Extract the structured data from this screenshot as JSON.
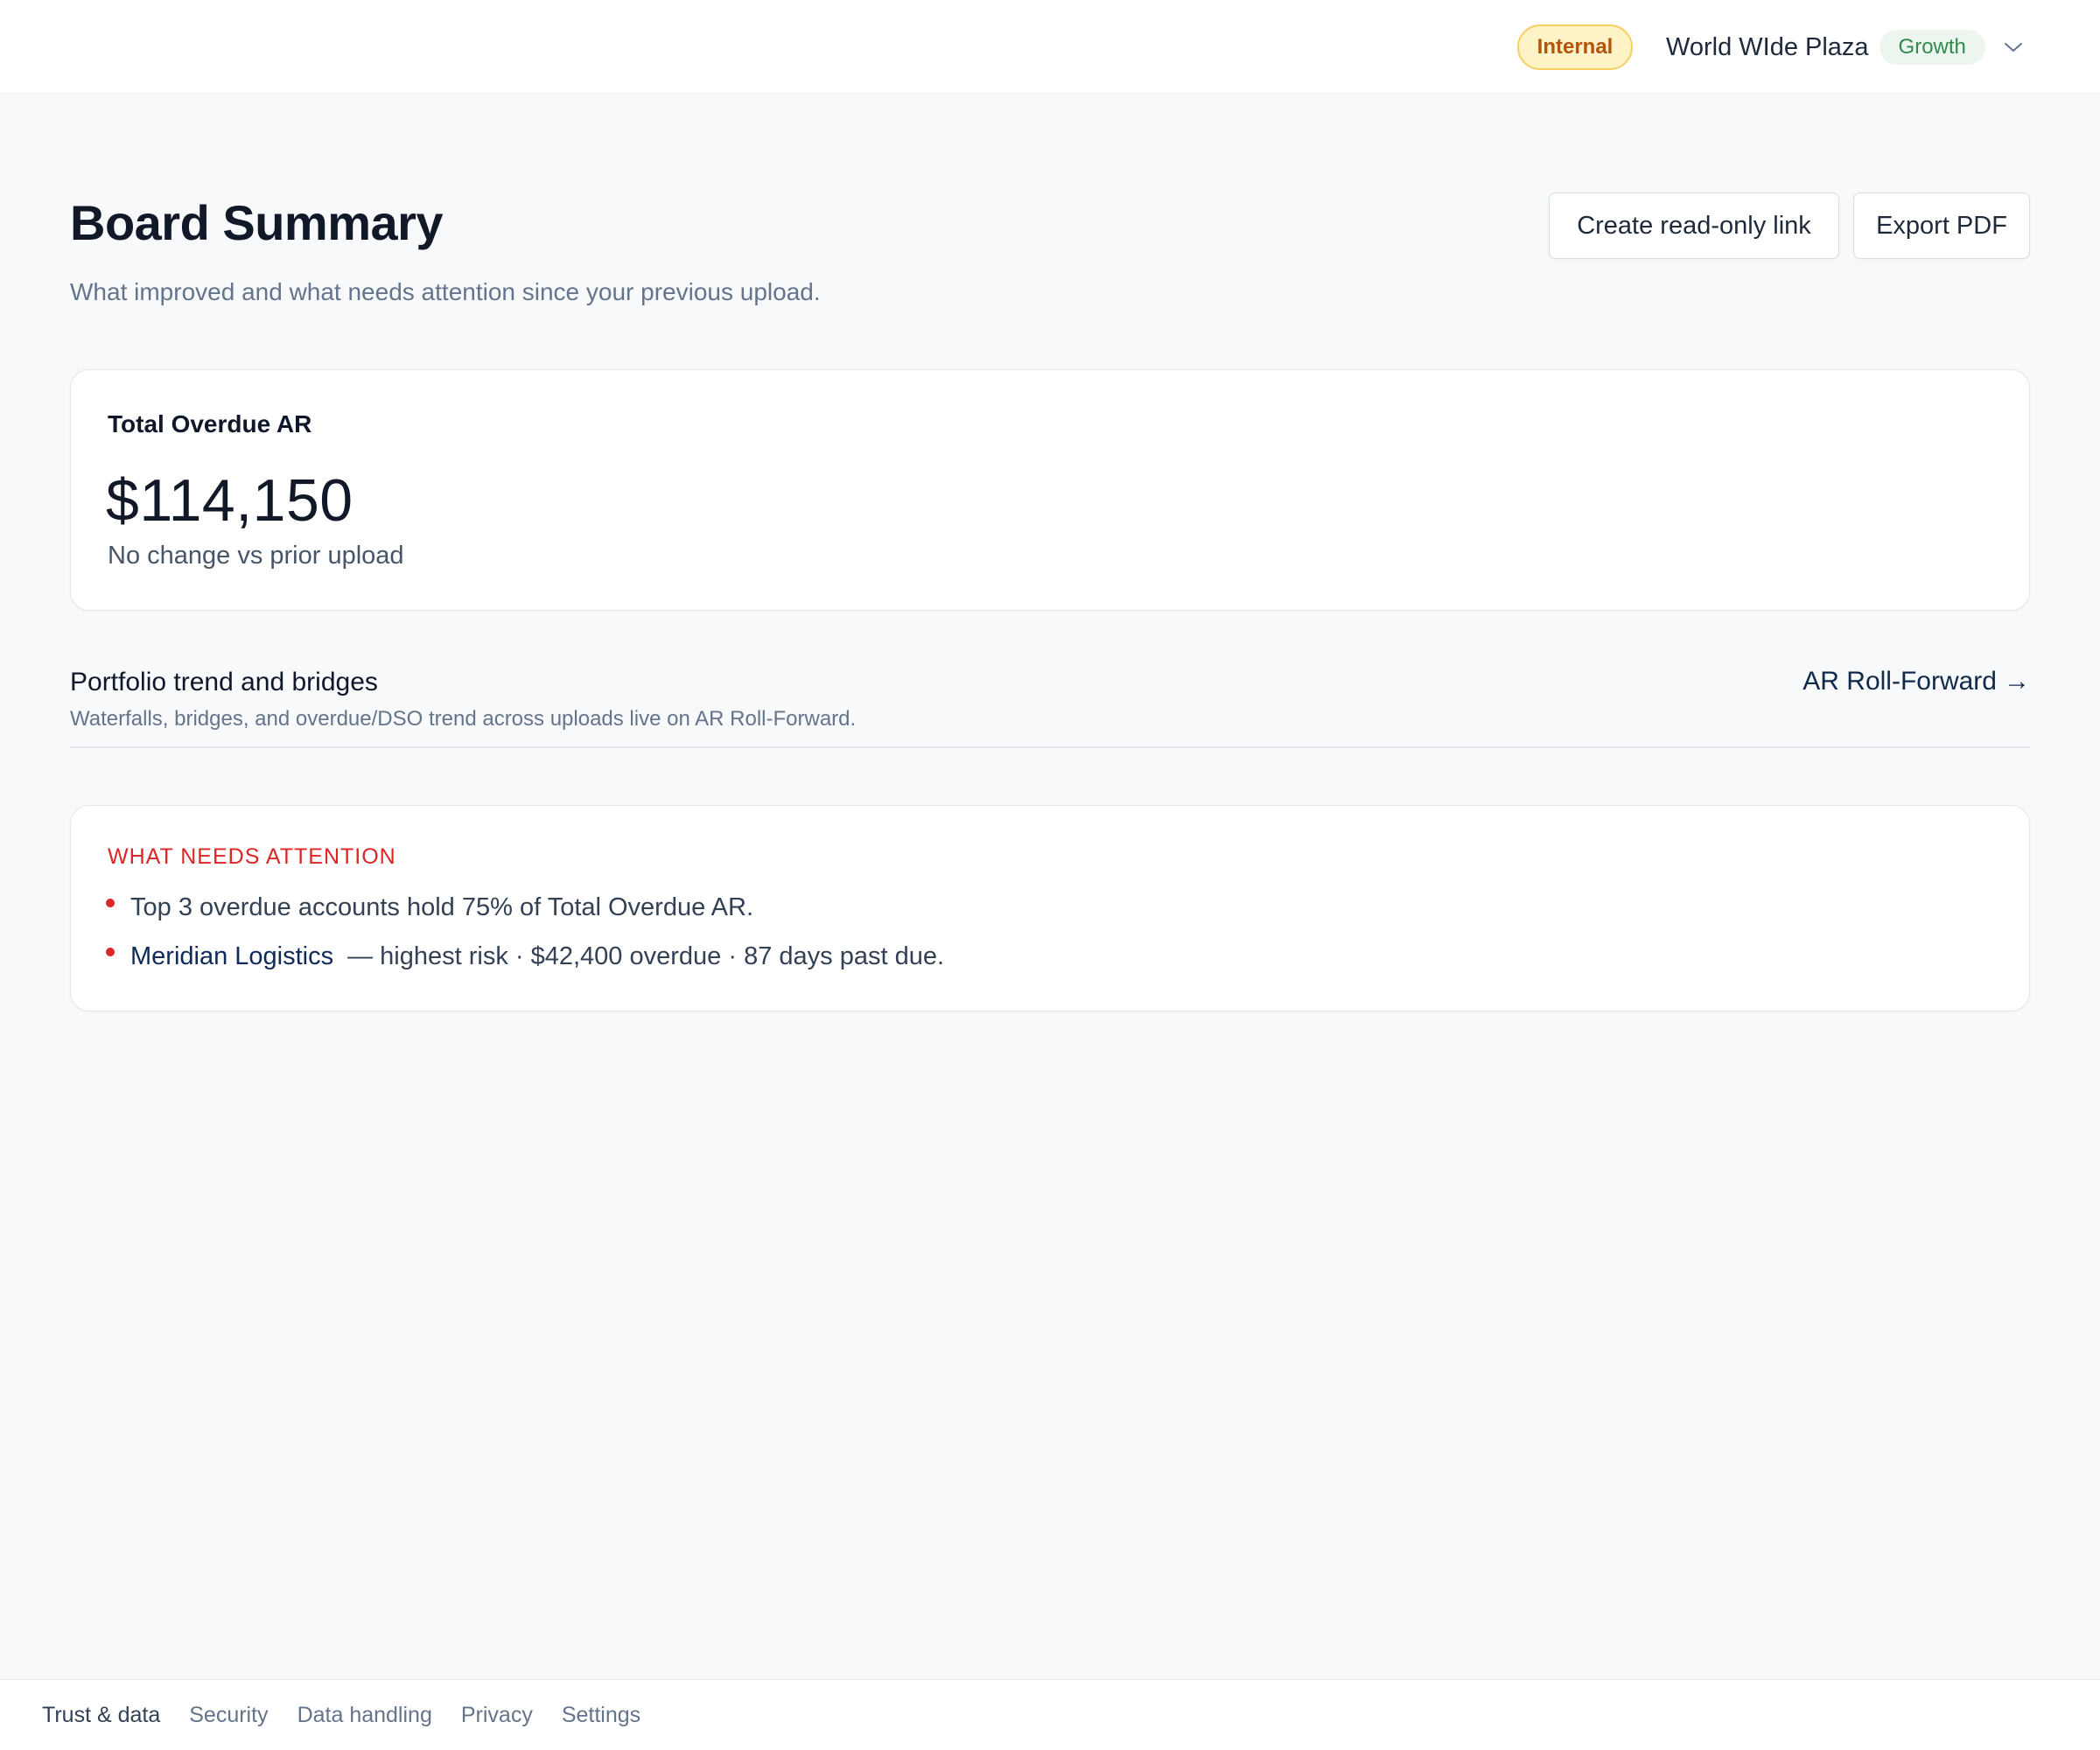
{
  "topbar": {
    "env_badge": "Internal",
    "org_name": "World WIde Plaza",
    "plan_badge": "Growth"
  },
  "header": {
    "title": "Board Summary",
    "subtitle": "What improved and what needs attention since your previous upload.",
    "create_link_label": "Create read-only link",
    "export_pdf_label": "Export PDF"
  },
  "kpi": {
    "label": "Total Overdue AR",
    "value": "$114,150",
    "delta": "No change vs prior upload"
  },
  "portfolio": {
    "title": "Portfolio trend and bridges",
    "description": "Waterfalls, bridges, and overdue/DSO trend across uploads live on AR Roll-Forward.",
    "link_label": "AR Roll-Forward",
    "link_arrow": "→"
  },
  "attention": {
    "heading": "WHAT NEEDS ATTENTION",
    "items": [
      {
        "text": "Top 3 overdue accounts hold 75% of Total Overdue AR."
      },
      {
        "link": "Meridian Logistics",
        "text": "— highest risk · $42,400 overdue · 87 days past due."
      }
    ]
  },
  "footer": {
    "items": [
      "Trust & data",
      "Security",
      "Data handling",
      "Privacy",
      "Settings"
    ]
  },
  "colors": {
    "accent_red": "#dc2626",
    "plan_green": "#2f8a4c",
    "env_amber": "#b4530a"
  },
  "icons": {
    "org_switcher": "chevron-down-icon",
    "roll_forward": "arrow-right-icon",
    "bullet": "bullet-dot-icon"
  }
}
